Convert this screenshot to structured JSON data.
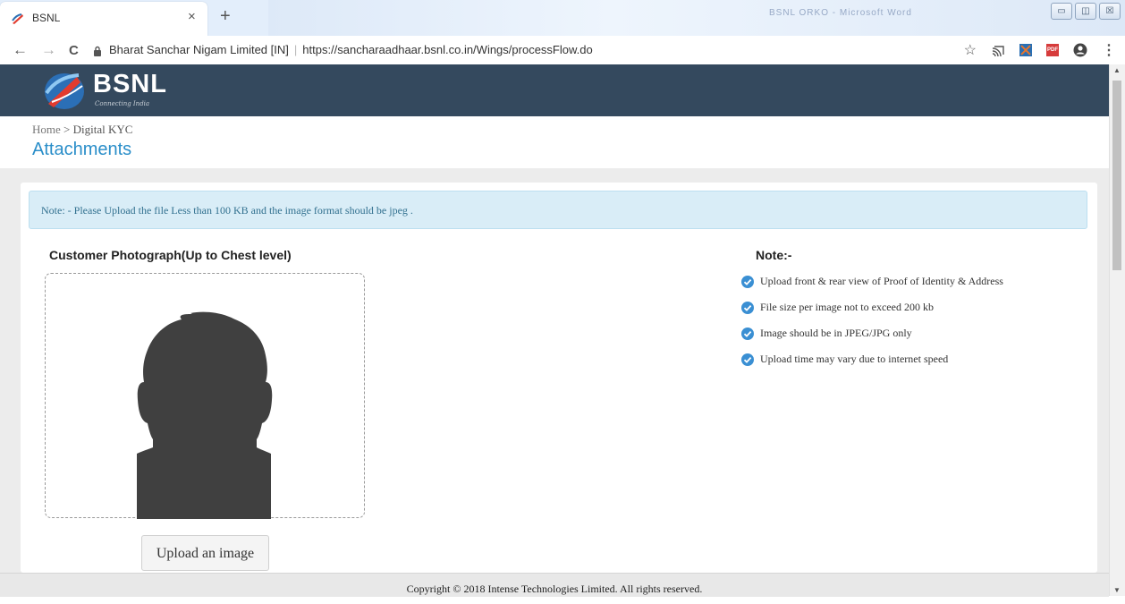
{
  "browser": {
    "tab_title": "BSNL",
    "tab_close": "×",
    "new_tab": "+",
    "background_window_title": "BSNL ORKO - Microsoft Word",
    "window_buttons": [
      "▭",
      "◫",
      "☒"
    ],
    "back": "←",
    "forward": "→",
    "reload": "C",
    "site_identity": "Bharat Sanchar Nigam Limited [IN]",
    "url": "https://sancharaadhaar.bsnl.co.in/Wings/processFlow.do",
    "star": "☆",
    "menu": "⋮"
  },
  "header": {
    "brand": "BSNL",
    "tagline": "Connecting India",
    "background_color": "#34495e"
  },
  "breadcrumb": {
    "home": "Home",
    "separator": ">",
    "current": "Digital KYC"
  },
  "page_title": "Attachments",
  "notice": "Note: - Please Upload the file Less than 100 KB and the image format should be jpeg .",
  "photo_section": {
    "heading": "Customer Photograph(Up to Chest level)",
    "upload_button": "Upload an image"
  },
  "notes": {
    "heading": "Note:-",
    "items": [
      "Upload front & rear view of Proof of Identity & Address",
      "File size per image not to exceed 200 kb",
      "Image should be in JPEG/JPG only",
      "Upload time may vary due to internet speed"
    ]
  },
  "footer": "Copyright © 2018 Intense Technologies Limited. All rights reserved.",
  "colors": {
    "accent": "#2a8ec9",
    "notice_bg": "#d9edf7",
    "check": "#3a8fd3"
  }
}
